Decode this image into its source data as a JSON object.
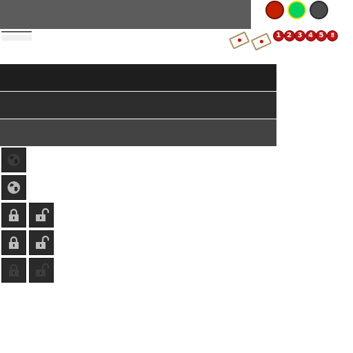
{
  "colors": {
    "title_strip": "#5c5c5c",
    "status_red": "#c42000",
    "status_green": "#00d45c",
    "status_green_ring": "#f2e000",
    "status_gray": "#4a4a4a",
    "bar_1": "#1e1e1e",
    "bar_2": "#2d2d2d",
    "bar_3": "#434343",
    "badge_red": "#c21414"
  },
  "status_lights": [
    {
      "name": "red",
      "color": "#c42000"
    },
    {
      "name": "green",
      "color": "#00d45c",
      "highlighted": true
    },
    {
      "name": "gray",
      "color": "#4a4a4a"
    }
  ],
  "badges": [
    "1",
    "2",
    "3",
    "4",
    "5",
    "!!"
  ],
  "icons": {
    "globe_disabled": "globe-icon",
    "globe": "globe-icon",
    "lock": "lock-icon",
    "unlock": "unlock-icon"
  },
  "bars": [
    {
      "color": "#1e1e1e"
    },
    {
      "color": "#2d2d2d"
    },
    {
      "color": "#434343"
    }
  ]
}
